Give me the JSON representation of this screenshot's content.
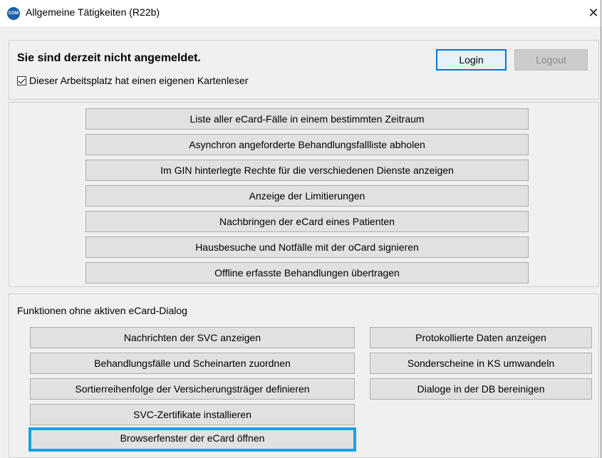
{
  "window": {
    "title": "Allgemeine Tätigkeiten (R22b)",
    "app_icon_text": "CGM",
    "close_glyph": "✕"
  },
  "login": {
    "status": "Sie sind derzeit nicht angemeldet.",
    "login_label": "Login",
    "logout_label": "Logout",
    "checkbox_label": "Dieser Arbeitsplatz hat einen eigenen Kartenleser",
    "checkbox_checked": true
  },
  "ecard_functions": [
    "Liste aller eCard-Fälle in einem bestimmten Zeitraum",
    "Asynchron angeforderte Behandlungsfallliste abholen",
    "Im GIN hinterlegte Rechte für die verschiedenen Dienste anzeigen",
    "Anzeige der Limitierungen",
    "Nachbringen der eCard eines Patienten",
    "Hausbesuche und Notfälle mit der oCard signieren",
    "Offline erfasste Behandlungen übertragen"
  ],
  "offline": {
    "section_label": "Funktionen ohne aktiven eCard-Dialog",
    "left_buttons": [
      "Nachrichten der SVC anzeigen",
      "Behandlungsfälle und Scheinarten zuordnen",
      "Sortierreihenfolge der Versicherungsträger definieren",
      "SVC-Zertifikate installieren",
      "Browserfenster der eCard öffnen"
    ],
    "right_buttons": [
      "Protokollierte Daten anzeigen",
      "Sonderscheine in KS umwandeln",
      "Dialoge in der DB bereinigen"
    ]
  },
  "colors": {
    "focus_border": "#1aa1e0",
    "login_border": "#0078d7",
    "icon_bg": "#1d5fa8"
  }
}
